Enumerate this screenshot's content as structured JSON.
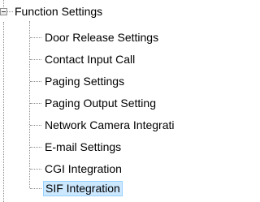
{
  "tree": {
    "root": {
      "label": "Function Settings",
      "expanded": true,
      "expander_icon": "minus-box-icon"
    },
    "children": [
      {
        "label": "Door Release Settings",
        "selected": false
      },
      {
        "label": "Contact Input Call",
        "selected": false
      },
      {
        "label": "Paging Settings",
        "selected": false
      },
      {
        "label": "Paging Output Setting",
        "selected": false
      },
      {
        "label": "Network Camera Integrati",
        "selected": false
      },
      {
        "label": "E-mail Settings",
        "selected": false
      },
      {
        "label": "CGI Integration",
        "selected": false
      },
      {
        "label": "SIF Integration",
        "selected": true
      }
    ],
    "colors": {
      "selection_background": "#cce8ff",
      "selection_border": "#99d1ff",
      "guide_line": "#8c8c8c",
      "text": "#000000"
    }
  }
}
